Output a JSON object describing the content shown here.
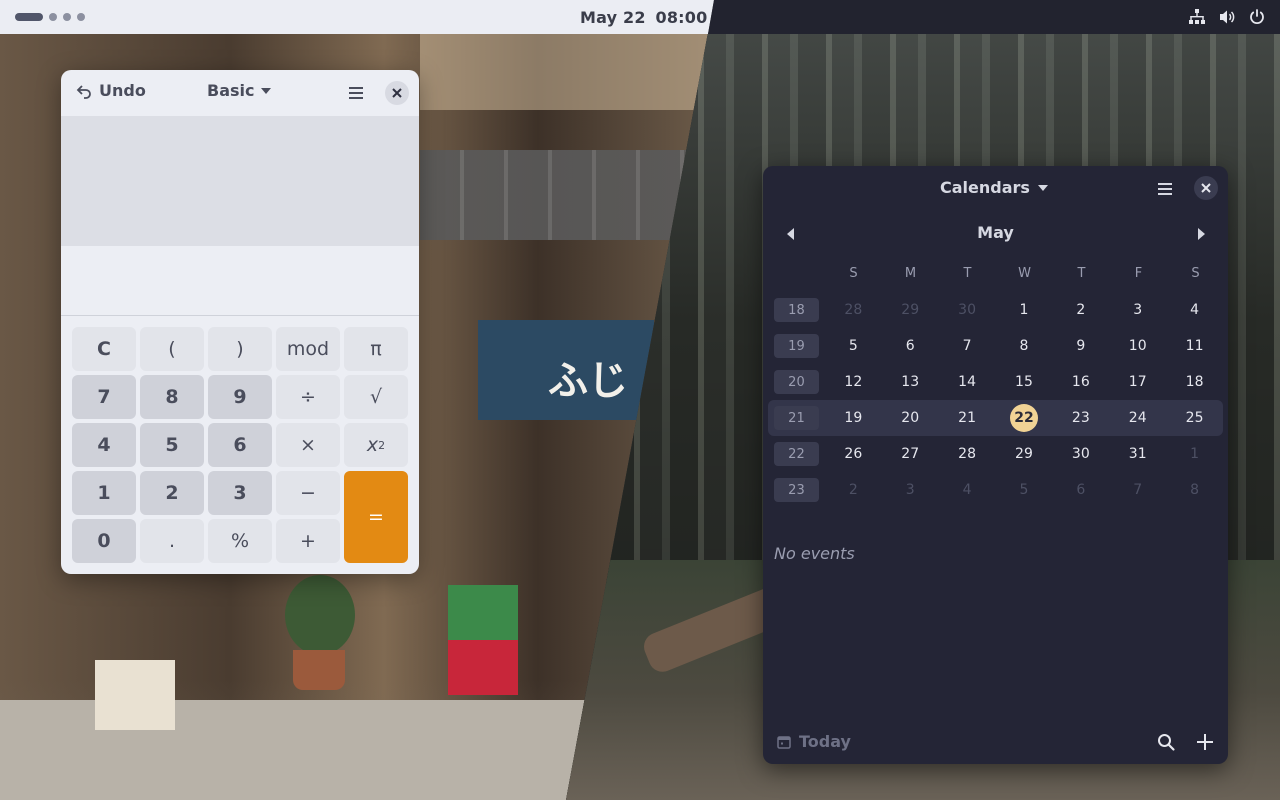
{
  "topbar": {
    "date": "May 22",
    "time": "08:00",
    "tray_icons": [
      "network-icon",
      "volume-icon",
      "power-icon"
    ]
  },
  "calculator": {
    "undo_label": "Undo",
    "mode_label": "Basic",
    "keys": [
      {
        "label": "C",
        "kind": "c"
      },
      {
        "label": "(",
        "kind": "op"
      },
      {
        "label": ")",
        "kind": "op"
      },
      {
        "label": "mod",
        "kind": "op"
      },
      {
        "label": "π",
        "kind": "op"
      },
      {
        "label": "7",
        "kind": "num"
      },
      {
        "label": "8",
        "kind": "num"
      },
      {
        "label": "9",
        "kind": "num"
      },
      {
        "label": "÷",
        "kind": "op"
      },
      {
        "label": "√",
        "kind": "op"
      },
      {
        "label": "4",
        "kind": "num"
      },
      {
        "label": "5",
        "kind": "num"
      },
      {
        "label": "6",
        "kind": "num"
      },
      {
        "label": "×",
        "kind": "op"
      },
      {
        "label": "x²",
        "kind": "op"
      },
      {
        "label": "1",
        "kind": "num"
      },
      {
        "label": "2",
        "kind": "num"
      },
      {
        "label": "3",
        "kind": "num"
      },
      {
        "label": "−",
        "kind": "op"
      },
      {
        "label": "=",
        "kind": "equals"
      },
      {
        "label": "0",
        "kind": "num"
      },
      {
        "label": ".",
        "kind": "op"
      },
      {
        "label": "%",
        "kind": "op"
      },
      {
        "label": "+",
        "kind": "op"
      }
    ],
    "accent": "#e38a13"
  },
  "calendar": {
    "title": "Calendars",
    "month": "May",
    "weekdays": [
      "S",
      "M",
      "T",
      "W",
      "T",
      "F",
      "S"
    ],
    "today": "22",
    "weeks": [
      {
        "num": "18",
        "days": [
          {
            "d": "28",
            "other": true
          },
          {
            "d": "29",
            "other": true
          },
          {
            "d": "30",
            "other": true
          },
          {
            "d": "1"
          },
          {
            "d": "2"
          },
          {
            "d": "3"
          },
          {
            "d": "4"
          }
        ]
      },
      {
        "num": "19",
        "days": [
          {
            "d": "5"
          },
          {
            "d": "6"
          },
          {
            "d": "7"
          },
          {
            "d": "8"
          },
          {
            "d": "9"
          },
          {
            "d": "10"
          },
          {
            "d": "11"
          }
        ]
      },
      {
        "num": "20",
        "days": [
          {
            "d": "12"
          },
          {
            "d": "13"
          },
          {
            "d": "14"
          },
          {
            "d": "15"
          },
          {
            "d": "16"
          },
          {
            "d": "17"
          },
          {
            "d": "18"
          }
        ]
      },
      {
        "num": "21",
        "current": true,
        "days": [
          {
            "d": "19"
          },
          {
            "d": "20"
          },
          {
            "d": "21"
          },
          {
            "d": "22",
            "today": true
          },
          {
            "d": "23"
          },
          {
            "d": "24"
          },
          {
            "d": "25"
          }
        ]
      },
      {
        "num": "22",
        "days": [
          {
            "d": "26"
          },
          {
            "d": "27"
          },
          {
            "d": "28"
          },
          {
            "d": "29"
          },
          {
            "d": "30"
          },
          {
            "d": "31"
          },
          {
            "d": "1",
            "other": true
          }
        ]
      },
      {
        "num": "23",
        "days": [
          {
            "d": "2",
            "other": true
          },
          {
            "d": "3",
            "other": true
          },
          {
            "d": "4",
            "other": true
          },
          {
            "d": "5",
            "other": true
          },
          {
            "d": "6",
            "other": true
          },
          {
            "d": "7",
            "other": true
          },
          {
            "d": "8",
            "other": true
          }
        ]
      }
    ],
    "no_events": "No events",
    "today_label": "Today",
    "today_color": "#f1d395"
  },
  "wallpaper": {
    "sign_text": "ふじ"
  }
}
